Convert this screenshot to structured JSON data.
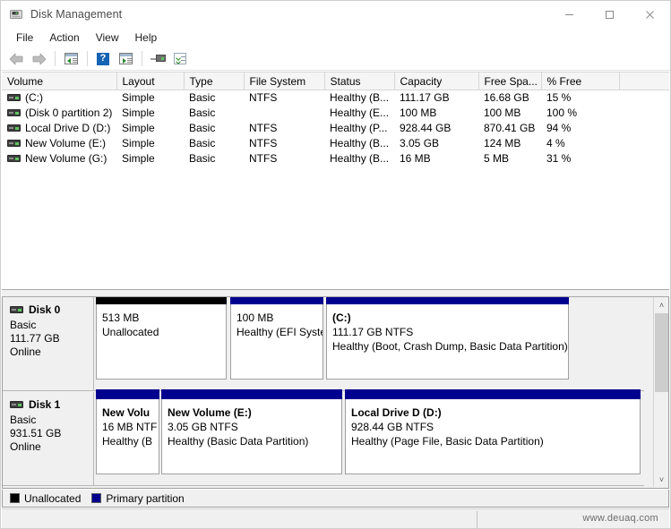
{
  "window": {
    "title": "Disk Management",
    "icon": "disk-management-icon",
    "controls": {
      "minimize": "–",
      "maximize": "□",
      "close": "✕"
    }
  },
  "menubar": {
    "items": [
      {
        "label": "File"
      },
      {
        "label": "Action"
      },
      {
        "label": "View"
      },
      {
        "label": "Help"
      }
    ]
  },
  "toolbar": {
    "buttons": [
      {
        "name": "back-arrow-icon"
      },
      {
        "name": "forward-arrow-icon"
      },
      {
        "name": "show-hide-console-tree-icon"
      },
      {
        "name": "help-icon"
      },
      {
        "name": "show-action-pane-icon"
      },
      {
        "name": "connect-to-another-computer-icon"
      },
      {
        "name": "properties-icon"
      }
    ]
  },
  "volume_list": {
    "columns": [
      "Volume",
      "Layout",
      "Type",
      "File System",
      "Status",
      "Capacity",
      "Free Spa...",
      "% Free",
      ""
    ],
    "rows": [
      {
        "volume": "(C:)",
        "layout": "Simple",
        "type": "Basic",
        "filesystem": "NTFS",
        "status": "Healthy (B...",
        "capacity": "111.17 GB",
        "free_space": "16.68 GB",
        "percent_free": "15 %"
      },
      {
        "volume": "(Disk 0 partition 2)",
        "layout": "Simple",
        "type": "Basic",
        "filesystem": "",
        "status": "Healthy (E...",
        "capacity": "100 MB",
        "free_space": "100 MB",
        "percent_free": "100 %"
      },
      {
        "volume": "Local Drive D (D:)",
        "layout": "Simple",
        "type": "Basic",
        "filesystem": "NTFS",
        "status": "Healthy (P...",
        "capacity": "928.44 GB",
        "free_space": "870.41 GB",
        "percent_free": "94 %"
      },
      {
        "volume": "New Volume (E:)",
        "layout": "Simple",
        "type": "Basic",
        "filesystem": "NTFS",
        "status": "Healthy (B...",
        "capacity": "3.05 GB",
        "free_space": "124 MB",
        "percent_free": "4 %"
      },
      {
        "volume": "New Volume (G:)",
        "layout": "Simple",
        "type": "Basic",
        "filesystem": "NTFS",
        "status": "Healthy (B...",
        "capacity": "16 MB",
        "free_space": "5 MB",
        "percent_free": "31 %"
      }
    ]
  },
  "graphical_view": {
    "disks": [
      {
        "name": "Disk 0",
        "type": "Basic",
        "size": "111.77 GB",
        "state": "Online",
        "partitions": [
          {
            "label": "",
            "size_fs": "513 MB",
            "status": "Unallocated",
            "color": "#000000",
            "kind": "unallocated"
          },
          {
            "label": "",
            "size_fs": "100 MB",
            "status": "Healthy (EFI Syste",
            "color": "#00008f",
            "kind": "primary"
          },
          {
            "label": "(C:)",
            "size_fs": "111.17 GB NTFS",
            "status": "Healthy (Boot, Crash Dump, Basic Data Partition)",
            "color": "#00008f",
            "kind": "primary"
          }
        ]
      },
      {
        "name": "Disk 1",
        "type": "Basic",
        "size": "931.51 GB",
        "state": "Online",
        "partitions": [
          {
            "label": "New Volu",
            "size_fs": "16 MB NTF",
            "status": "Healthy (B",
            "color": "#00008f",
            "kind": "primary"
          },
          {
            "label": "New Volume  (E:)",
            "size_fs": "3.05 GB NTFS",
            "status": "Healthy (Basic Data Partition)",
            "color": "#00008f",
            "kind": "primary"
          },
          {
            "label": "Local Drive D  (D:)",
            "size_fs": "928.44 GB NTFS",
            "status": "Healthy (Page File, Basic Data Partition)",
            "color": "#00008f",
            "kind": "primary"
          }
        ]
      }
    ],
    "scrollbar": {
      "up_arrow": "˄",
      "down_arrow": "˅"
    }
  },
  "legend": {
    "items": [
      {
        "label": "Unallocated",
        "color": "#000000"
      },
      {
        "label": "Primary partition",
        "color": "#00008f"
      }
    ]
  },
  "statusbar": {
    "watermark": "www.deuaq.com"
  }
}
